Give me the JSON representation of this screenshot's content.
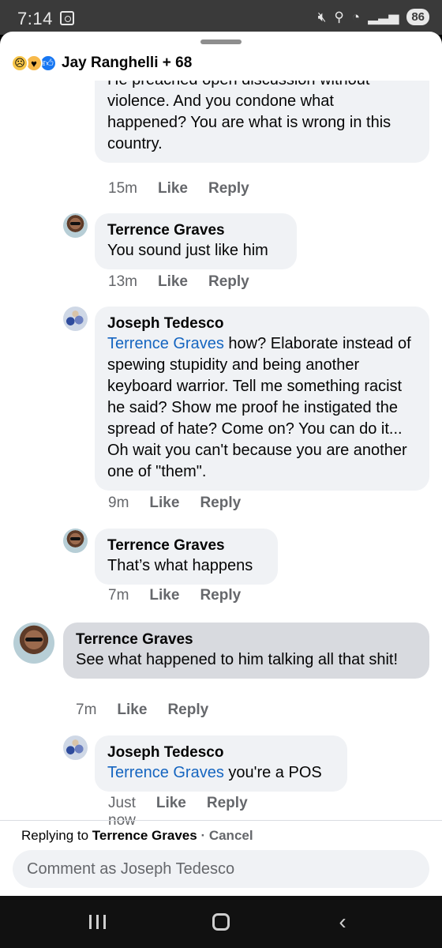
{
  "status_bar": {
    "time": "7:14",
    "battery": "86"
  },
  "header": {
    "title": "Jay Ranghelli + 68",
    "reactions": [
      "sad-reaction",
      "care-reaction",
      "like-reaction"
    ]
  },
  "comments": [
    {
      "author": "",
      "mention": "",
      "text": "He preached open discussion without violence. And you condone what happened? You are what is wrong in this country.",
      "time": "15m",
      "like": "Like",
      "reply": "Reply"
    },
    {
      "author": "Terrence Graves",
      "mention": "",
      "text": "You sound just like him",
      "time": "13m",
      "like": "Like",
      "reply": "Reply"
    },
    {
      "author": "Joseph Tedesco",
      "mention": "Terrence Graves",
      "text": " how? Elaborate instead of spewing stupidity and being another keyboard warrior. Tell me something racist he said? Show me proof he instigated the spread of hate? Come on? You can do it... Oh wait you can't because you are another one of \"them\".",
      "time": "9m",
      "like": "Like",
      "reply": "Reply"
    },
    {
      "author": "Terrence Graves",
      "mention": "",
      "text": "That’s what happens",
      "time": "7m",
      "like": "Like",
      "reply": "Reply"
    },
    {
      "author": "Terrence Graves",
      "mention": "",
      "text": "See what happened to him talking all that shit!",
      "time": "7m",
      "like": "Like",
      "reply": "Reply"
    },
    {
      "author": "Joseph Tedesco",
      "mention": "Terrence Graves",
      "text": " you're a POS",
      "time": "Just now",
      "like": "Like",
      "reply": "Reply"
    }
  ],
  "reply_bar": {
    "prefix": "Replying to ",
    "target": "Terrence Graves",
    "separator": " · ",
    "cancel": "Cancel"
  },
  "composer": {
    "placeholder": "Comment as Joseph Tedesco"
  },
  "colors": {
    "mention": "#1565c0",
    "bubble": "#f0f2f5",
    "highlight_bubble": "#d8dadf",
    "meta": "#65676b"
  },
  "nav": {
    "recents_icon": "recents-icon",
    "home_icon": "home-icon",
    "back_icon": "back-icon"
  }
}
